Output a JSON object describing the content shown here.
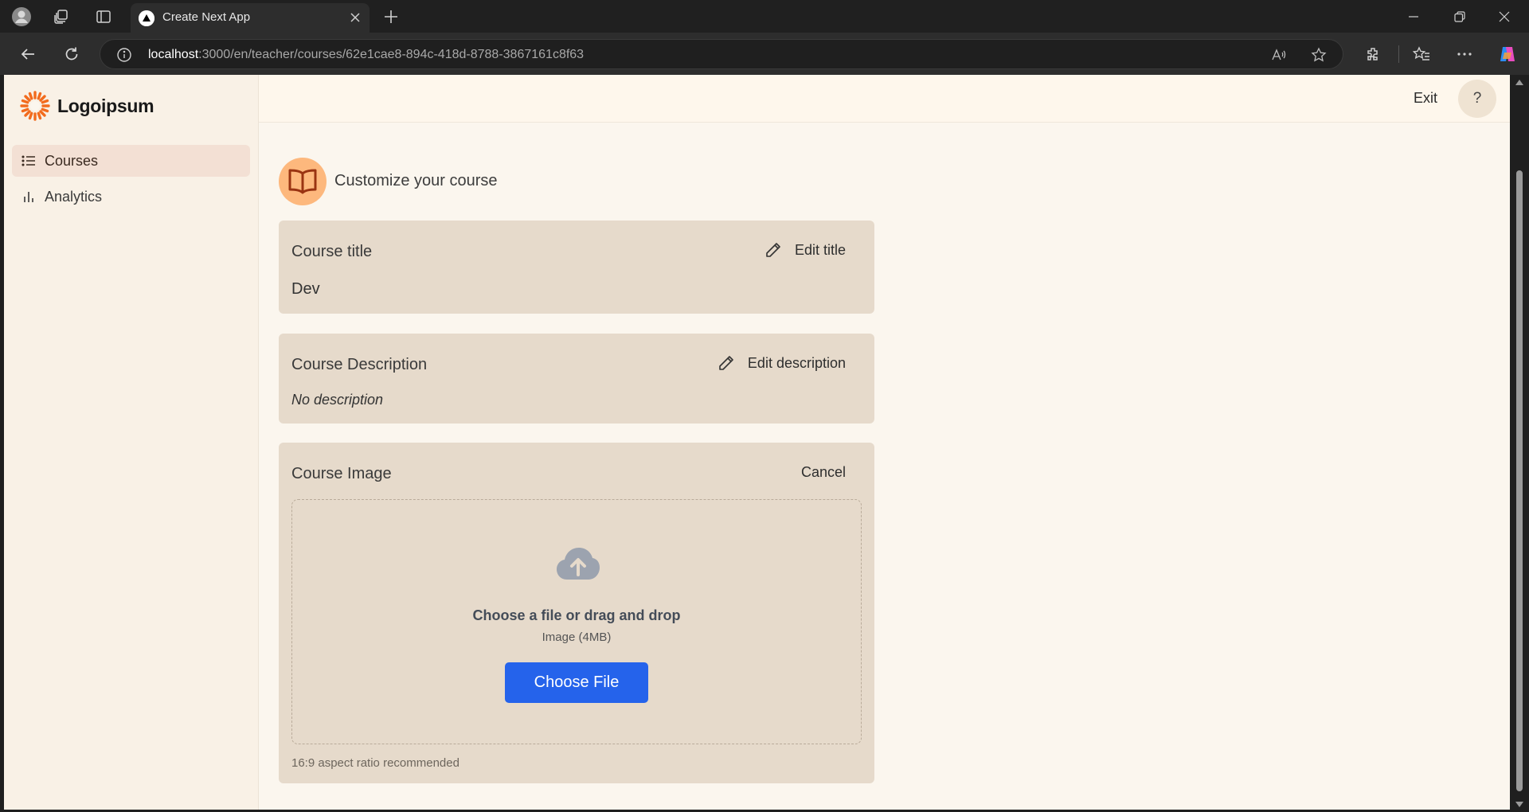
{
  "browser": {
    "tab_title": "Create Next App",
    "url_host": "localhost",
    "url_rest": ":3000/en/teacher/courses/62e1cae8-894c-418d-8788-3867161c8f63"
  },
  "sidebar": {
    "logo_text": "Logoipsum",
    "items": [
      {
        "label": "Courses",
        "icon": "list-icon",
        "active": true
      },
      {
        "label": "Analytics",
        "icon": "bar-chart-icon",
        "active": false
      }
    ]
  },
  "topbar": {
    "exit_label": "Exit",
    "help_label": "?"
  },
  "main": {
    "header_title": "Customize your course",
    "title_card": {
      "label": "Course title",
      "action": "Edit title",
      "value": "Dev"
    },
    "description_card": {
      "label": "Course Description",
      "action": "Edit description",
      "value": "No description"
    },
    "image_card": {
      "label": "Course Image",
      "action": "Cancel",
      "dropzone_title": "Choose a file or drag and drop",
      "dropzone_sub": "Image (4MB)",
      "choose_button": "Choose File",
      "aspect_note": "16:9 aspect ratio recommended"
    }
  },
  "colors": {
    "accent_blue": "#2563eb",
    "header_icon_bg": "#fdb87d",
    "card_bg": "#e6dacb",
    "sidebar_active": "#f3e0d4"
  }
}
